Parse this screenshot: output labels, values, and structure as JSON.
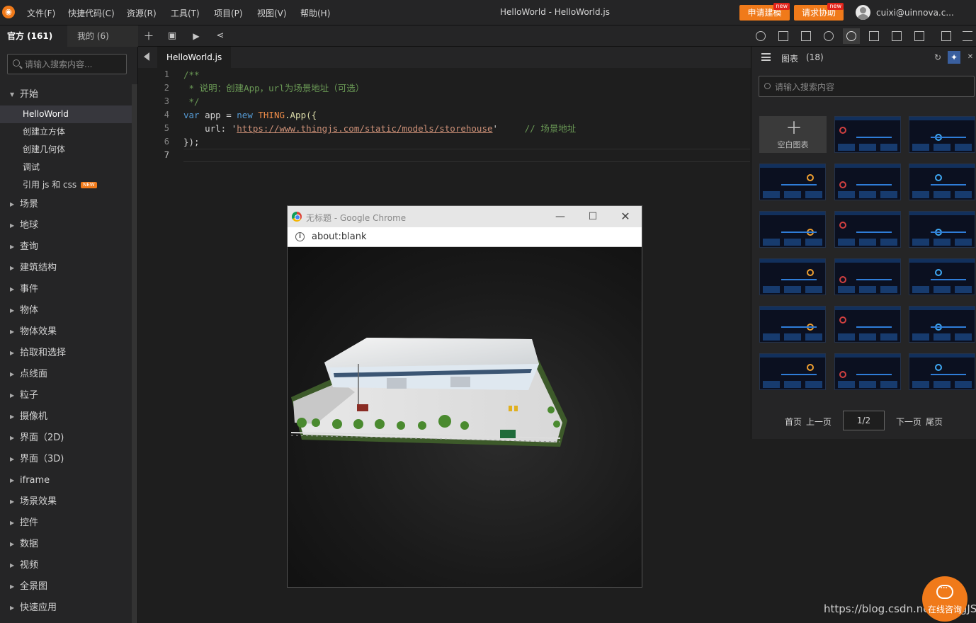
{
  "menubar": {
    "items": [
      "文件(F)",
      "快捷代码(C)",
      "资源(R)",
      "工具(T)",
      "项目(P)",
      "视图(V)",
      "帮助(H)"
    ],
    "title": "HelloWorld -  HelloWorld.js",
    "buttons": [
      "申请建模",
      "请求协助"
    ],
    "new_tag": "new",
    "user": "cuixi@uinnova.c..."
  },
  "sidebar": {
    "tabs": [
      "官方 (161)",
      "我的 (6)"
    ],
    "search_placeholder": "请输入搜索内容...",
    "open_category": "开始",
    "sub_items": [
      "HelloWorld",
      "创建立方体",
      "创建几何体",
      "调试",
      "引用 js 和 css"
    ],
    "new_badge": "NEW",
    "categories": [
      "场景",
      "地球",
      "查询",
      "建筑结构",
      "事件",
      "物体",
      "物体效果",
      "拾取和选择",
      "点线面",
      "粒子",
      "摄像机",
      "界面（2D)",
      "界面（3D)",
      "iframe",
      "场景效果",
      "控件",
      "数据",
      "视频",
      "全景图",
      "快速应用"
    ]
  },
  "editor": {
    "tab": "HelloWorld.js",
    "line_numbers": [
      "1",
      "2",
      "3",
      "4",
      "5",
      "6",
      "7"
    ],
    "code": {
      "l1": "/**",
      "l2": " * 说明：创建App，url为场景地址（可选）",
      "l3": " */",
      "l4_kw": "var",
      "l4_id": " app = ",
      "l4_new": "new",
      "l4_cls": " THING",
      "l4_rest": ".App({",
      "l5_key": "    url: '",
      "l5_url": "https://www.thingjs.com/static/models/storehouse",
      "l5_end": "'",
      "l5_cm": "     // 场景地址",
      "l6": "});"
    }
  },
  "chrome": {
    "title": "无标题 - Google Chrome",
    "url": "about:blank"
  },
  "panel": {
    "title": "图表",
    "count": "(18)",
    "search_placeholder": "请输入搜索内容",
    "blank_label": "空白图表",
    "pager": {
      "first": "首页",
      "prev": "上一页",
      "page": "1/2",
      "next": "下一页",
      "last": "尾页"
    }
  },
  "footer": {
    "watermark": "https://blog.csdn.net/ThingJS",
    "chat_label": "在线咨询"
  },
  "colors": {
    "accent": "#f07a1a",
    "comment": "#6a9955",
    "keyword": "#569cd6"
  }
}
